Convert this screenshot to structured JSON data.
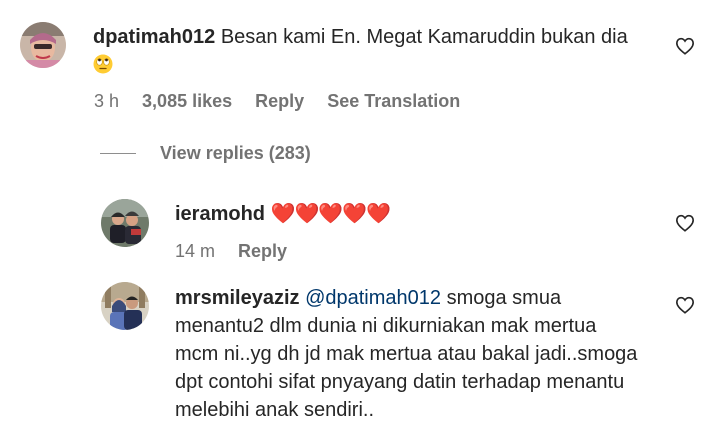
{
  "comment1": {
    "username": "dpatimah012",
    "text": "Besan kami En. Megat Kamaruddin bukan dia",
    "emoji": "rolling-eyes-emoji",
    "time": "3 h",
    "likes": "3,085 likes",
    "reply_label": "Reply",
    "translate_label": "See Translation"
  },
  "view_replies": "View replies (283)",
  "reply1": {
    "username": "ieramohd",
    "hearts": "❤️❤️❤️❤️❤️",
    "time": "14 m",
    "reply_label": "Reply"
  },
  "reply2": {
    "username": "mrsmileyaziz",
    "mention": "@dpatimah012",
    "text": "smoga smua menantu2 dlm dunia ni dikurniakan mak mertua mcm ni..yg dh jd mak mertua atau bakal jadi..smoga dpt contohi sifat pnyayang datin terhadap menantu melebihi anak sendiri.."
  },
  "colors": {
    "text": "#262626",
    "meta": "#737373",
    "mention": "#00376b",
    "heart_emoji": "#ff1a1a"
  }
}
